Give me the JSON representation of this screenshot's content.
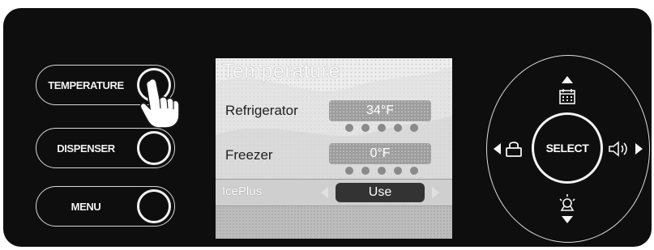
{
  "left_buttons": {
    "temperature_label": "TEMPERATURE",
    "dispenser_label": "DISPENSER",
    "menu_label": "MENU"
  },
  "screen": {
    "title": "Temperature",
    "refrigerator": {
      "label": "Refrigerator",
      "value": "34°F"
    },
    "freezer": {
      "label": "Freezer",
      "value": "0°F"
    },
    "iceplus": {
      "label": "IcePlus",
      "value": "Use"
    }
  },
  "dpad": {
    "select_label": "SELECT",
    "icons": {
      "up": "calendar-icon",
      "left": "lock-icon",
      "right": "speaker-icon",
      "down": "light-bulb-icon"
    }
  },
  "colors": {
    "panel": "#0e0e0e",
    "screen": "#ededed",
    "value_box": "#9d9d9d",
    "use_box": "#333333"
  }
}
